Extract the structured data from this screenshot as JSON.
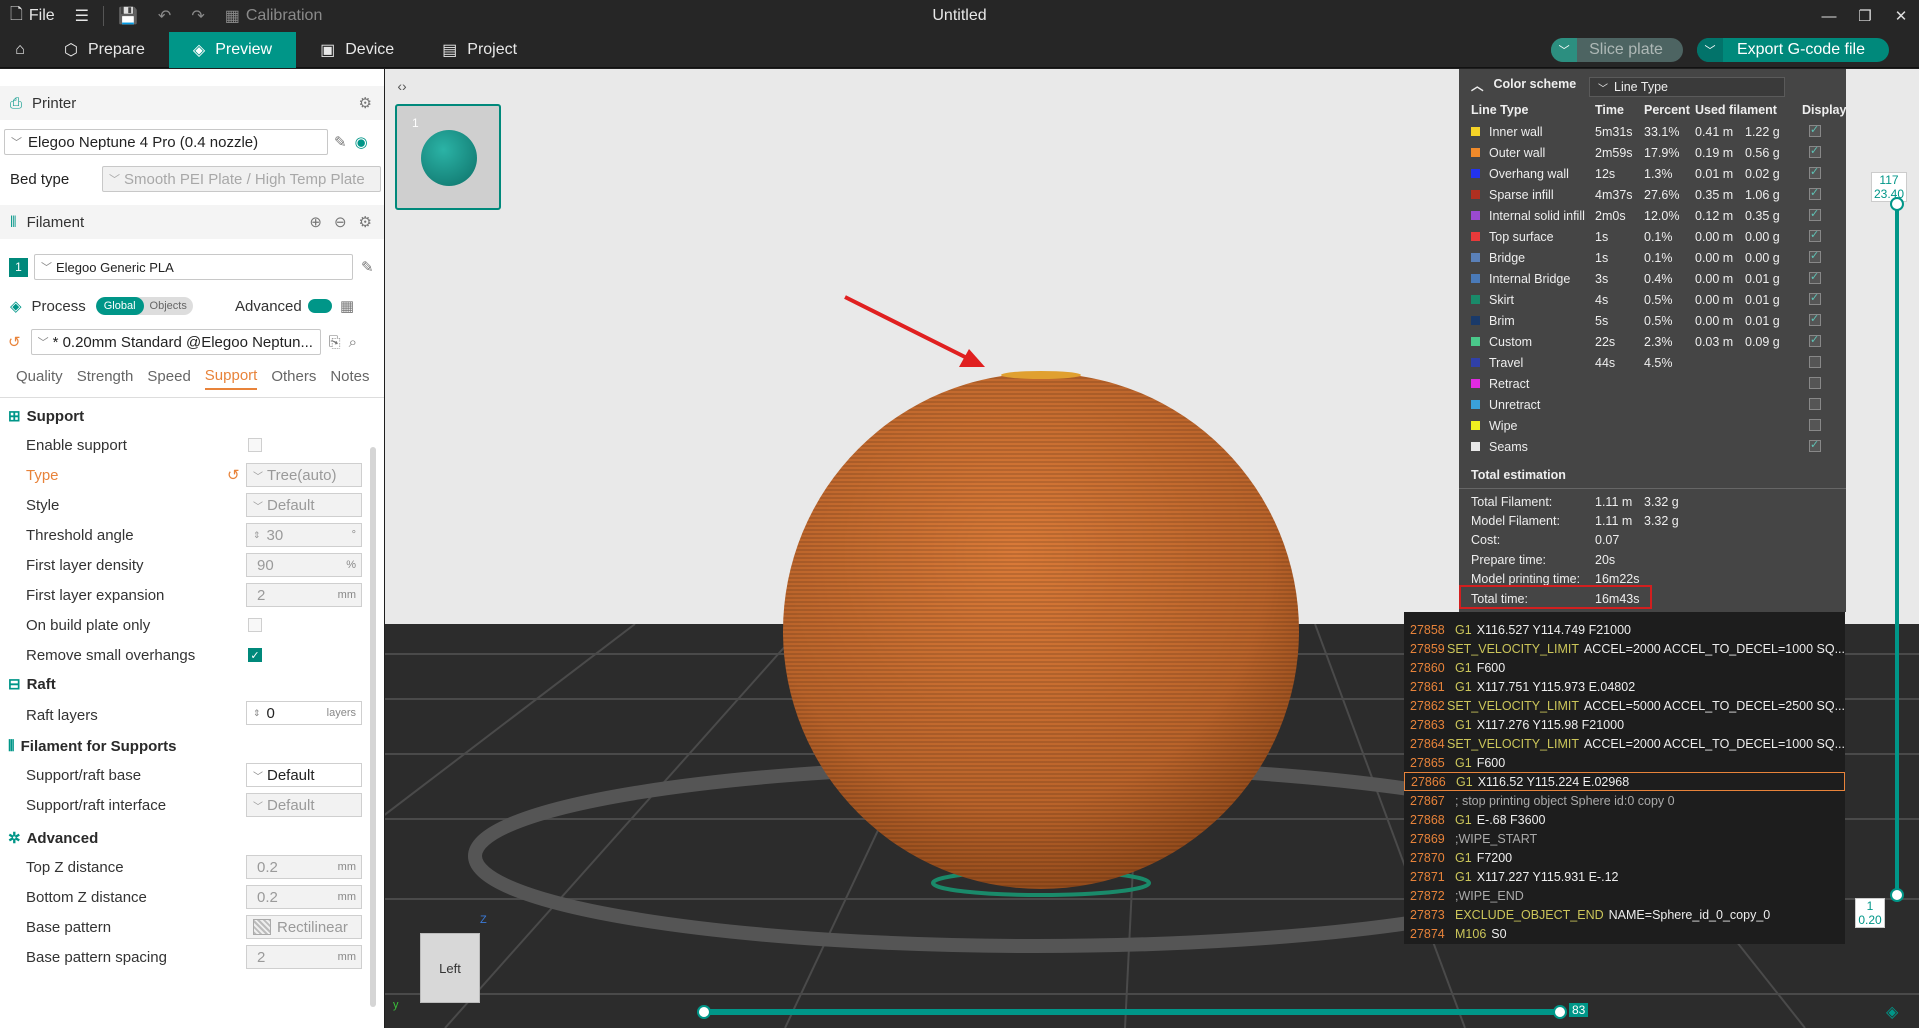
{
  "titlebar": {
    "file": "File",
    "calibration": "Calibration",
    "title": "Untitled"
  },
  "nav": {
    "prepare": "Prepare",
    "preview": "Preview",
    "device": "Device",
    "project": "Project",
    "slice": "Slice plate",
    "export": "Export G-code file"
  },
  "printer": {
    "section": "Printer",
    "name": "Elegoo Neptune 4 Pro (0.4 nozzle)",
    "bed_label": "Bed type",
    "bed_value": "Smooth PEI Plate / High Temp Plate"
  },
  "filament": {
    "section": "Filament",
    "slot": "1",
    "name": "Elegoo Generic PLA"
  },
  "process": {
    "section": "Process",
    "global": "Global",
    "objects": "Objects",
    "advanced": "Advanced",
    "preset": "* 0.20mm Standard @Elegoo Neptun...",
    "tabs": [
      "Quality",
      "Strength",
      "Speed",
      "Support",
      "Others",
      "Notes"
    ]
  },
  "support": {
    "title": "Support",
    "enable": "Enable support",
    "type_label": "Type",
    "type_value": "Tree(auto)",
    "style_label": "Style",
    "style_value": "Default",
    "threshold_label": "Threshold angle",
    "threshold_value": "30",
    "threshold_unit": "°",
    "fld_label": "First layer density",
    "fld_value": "90",
    "fld_unit": "%",
    "fle_label": "First layer expansion",
    "fle_value": "2",
    "fle_unit": "mm",
    "obp_label": "On build plate only",
    "rso_label": "Remove small overhangs"
  },
  "raft": {
    "title": "Raft",
    "layers_label": "Raft layers",
    "layers_value": "0",
    "layers_unit": "layers"
  },
  "ffs": {
    "title": "Filament for Supports",
    "base_label": "Support/raft base",
    "base_value": "Default",
    "iface_label": "Support/raft interface",
    "iface_value": "Default"
  },
  "advanced": {
    "title": "Advanced",
    "topz_label": "Top Z distance",
    "topz_value": "0.2",
    "unit_mm": "mm",
    "botz_label": "Bottom Z distance",
    "botz_value": "0.2",
    "bp_label": "Base pattern",
    "bp_value": "Rectilinear",
    "bps_label": "Base pattern spacing",
    "bps_value": "2"
  },
  "viewport": {
    "plate_number": "1",
    "view_cube": "Left",
    "axis_z": "Z",
    "axis_y": "y"
  },
  "color_scheme": {
    "title": "Color scheme",
    "mode": "Line Type",
    "headers": [
      "Line Type",
      "Time",
      "Percent",
      "Used filament",
      "Display"
    ],
    "rows": [
      {
        "name": "Inner wall",
        "color": "#f5d327",
        "time": "5m31s",
        "pct": "33.1%",
        "len": "0.41 m",
        "g": "1.22 g",
        "on": true
      },
      {
        "name": "Outer wall",
        "color": "#f08a2a",
        "time": "2m59s",
        "pct": "17.9%",
        "len": "0.19 m",
        "g": "0.56 g",
        "on": true
      },
      {
        "name": "Overhang wall",
        "color": "#2233ee",
        "time": "12s",
        "pct": "1.3%",
        "len": "0.01 m",
        "g": "0.02 g",
        "on": true
      },
      {
        "name": "Sparse infill",
        "color": "#b03020",
        "time": "4m37s",
        "pct": "27.6%",
        "len": "0.35 m",
        "g": "1.06 g",
        "on": true
      },
      {
        "name": "Internal solid infill",
        "color": "#9a4ad0",
        "time": "2m0s",
        "pct": "12.0%",
        "len": "0.12 m",
        "g": "0.35 g",
        "on": true
      },
      {
        "name": "Top surface",
        "color": "#e83a3a",
        "time": "1s",
        "pct": "0.1%",
        "len": "0.00 m",
        "g": "0.00 g",
        "on": true
      },
      {
        "name": "Bridge",
        "color": "#5a80b8",
        "time": "1s",
        "pct": "0.1%",
        "len": "0.00 m",
        "g": "0.00 g",
        "on": true
      },
      {
        "name": "Internal Bridge",
        "color": "#4a7ab8",
        "time": "3s",
        "pct": "0.4%",
        "len": "0.00 m",
        "g": "0.01 g",
        "on": true
      },
      {
        "name": "Skirt",
        "color": "#1a8a6a",
        "time": "4s",
        "pct": "0.5%",
        "len": "0.00 m",
        "g": "0.01 g",
        "on": true
      },
      {
        "name": "Brim",
        "color": "#1a3a6a",
        "time": "5s",
        "pct": "0.5%",
        "len": "0.00 m",
        "g": "0.01 g",
        "on": true
      },
      {
        "name": "Custom",
        "color": "#4ac88a",
        "time": "22s",
        "pct": "2.3%",
        "len": "0.03 m",
        "g": "0.09 g",
        "on": true
      },
      {
        "name": "Travel",
        "color": "#3040a8",
        "time": "44s",
        "pct": "4.5%",
        "len": "",
        "g": "",
        "on": false
      },
      {
        "name": "Retract",
        "color": "#e02ae0",
        "time": "",
        "pct": "",
        "len": "",
        "g": "",
        "on": false
      },
      {
        "name": "Unretract",
        "color": "#3aa0d8",
        "time": "",
        "pct": "",
        "len": "",
        "g": "",
        "on": false
      },
      {
        "name": "Wipe",
        "color": "#f0f020",
        "time": "",
        "pct": "",
        "len": "",
        "g": "",
        "on": false
      },
      {
        "name": "Seams",
        "color": "#e8e8e8",
        "time": "",
        "pct": "",
        "len": "",
        "g": "",
        "on": true
      }
    ],
    "estimation_title": "Total estimation",
    "est": [
      {
        "k": "Total Filament:",
        "v": "1.11 m",
        "v2": "3.32 g"
      },
      {
        "k": "Model Filament:",
        "v": "1.11 m",
        "v2": "3.32 g"
      },
      {
        "k": "Cost:",
        "v": "0.07",
        "v2": ""
      },
      {
        "k": "Prepare time:",
        "v": "20s",
        "v2": ""
      },
      {
        "k": "Model printing time:",
        "v": "16m22s",
        "v2": ""
      },
      {
        "k": "Total time:",
        "v": "16m43s",
        "v2": ""
      }
    ]
  },
  "gcode": [
    {
      "n": "27858",
      "c": "G1",
      "a": "X116.527 Y114.749 F21000"
    },
    {
      "n": "27859",
      "c": "SET_VELOCITY_LIMIT",
      "a": "ACCEL=2000 ACCEL_TO_DECEL=1000 SQ..."
    },
    {
      "n": "27860",
      "c": "G1",
      "a": "F600"
    },
    {
      "n": "27861",
      "c": "G1",
      "a": "X117.751 Y115.973 E.04802"
    },
    {
      "n": "27862",
      "c": "SET_VELOCITY_LIMIT",
      "a": "ACCEL=5000 ACCEL_TO_DECEL=2500 SQ..."
    },
    {
      "n": "27863",
      "c": "G1",
      "a": "X117.276 Y115.98 F21000"
    },
    {
      "n": "27864",
      "c": "SET_VELOCITY_LIMIT",
      "a": "ACCEL=2000 ACCEL_TO_DECEL=1000 SQ..."
    },
    {
      "n": "27865",
      "c": "G1",
      "a": "F600"
    },
    {
      "n": "27866",
      "c": "G1",
      "a": "X116.52 Y115.224 E.02968"
    },
    {
      "n": "27867",
      "c": "; stop printing object Sphere id:0 copy 0",
      "a": ""
    },
    {
      "n": "27868",
      "c": "G1",
      "a": "E-.68 F3600"
    },
    {
      "n": "27869",
      "c": ";WIPE_START",
      "a": ""
    },
    {
      "n": "27870",
      "c": "G1",
      "a": "F7200"
    },
    {
      "n": "27871",
      "c": "G1",
      "a": "X117.227 Y115.931 E-.12"
    },
    {
      "n": "27872",
      "c": ";WIPE_END",
      "a": ""
    },
    {
      "n": "27873",
      "c": "EXCLUDE_OBJECT_END",
      "a": "NAME=Sphere_id_0_copy_0"
    },
    {
      "n": "27874",
      "c": "M106",
      "a": "S0"
    }
  ],
  "gcode_highlight": "27866",
  "layer_slider": {
    "top_layer": "117",
    "top_z": "23.40",
    "bottom_layer": "1",
    "bottom_z": "0.20"
  },
  "move_slider": {
    "value": "83"
  },
  "colors": {
    "accent": "#009688",
    "highlight": "#e8833a",
    "annotation": "#e02020"
  }
}
